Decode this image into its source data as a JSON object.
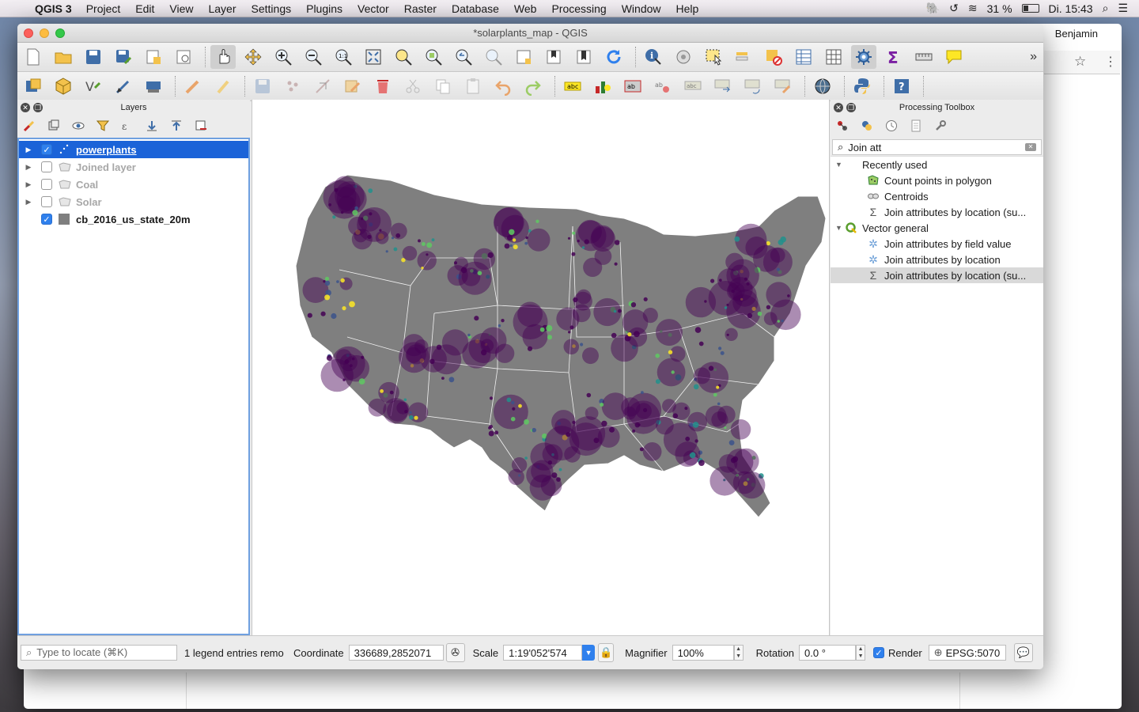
{
  "menubar": {
    "app_name": "QGIS 3",
    "items": [
      "Project",
      "Edit",
      "View",
      "Layer",
      "Settings",
      "Plugins",
      "Vector",
      "Raster",
      "Database",
      "Web",
      "Processing",
      "Window",
      "Help"
    ],
    "battery": "31 %",
    "clock": "Di. 15:43"
  },
  "background_window": {
    "user": "Benjamin"
  },
  "window": {
    "title": "*solarplants_map - QGIS"
  },
  "layers_panel": {
    "title": "Layers",
    "layers": [
      {
        "name": "powerplants",
        "checked": true,
        "selected": true,
        "icon": "point-layer-icon",
        "expandable": true
      },
      {
        "name": "Joined layer",
        "checked": false,
        "selected": false,
        "icon": "polygon-layer-icon",
        "expandable": true
      },
      {
        "name": "Coal",
        "checked": false,
        "selected": false,
        "icon": "polygon-layer-icon",
        "expandable": true
      },
      {
        "name": "Solar",
        "checked": false,
        "selected": false,
        "icon": "polygon-layer-icon",
        "expandable": true
      },
      {
        "name": "cb_2016_us_state_20m",
        "checked": true,
        "selected": false,
        "icon": "fill-swatch-icon",
        "expandable": false
      }
    ]
  },
  "processing_toolbox": {
    "title": "Processing Toolbox",
    "search_value": "Join att",
    "groups": [
      {
        "name": "Recently used",
        "items": [
          {
            "label": "Count points in polygon",
            "icon": "count-points-icon"
          },
          {
            "label": "Centroids",
            "icon": "centroids-icon"
          },
          {
            "label": "Join attributes by location (su...",
            "icon": "sigma-icon"
          }
        ]
      },
      {
        "name": "Vector general",
        "items": [
          {
            "label": "Join attributes by field value",
            "icon": "gear-icon"
          },
          {
            "label": "Join attributes by location",
            "icon": "gear-icon"
          },
          {
            "label": "Join attributes by location (su...",
            "icon": "sigma-icon",
            "selected": true
          }
        ]
      }
    ]
  },
  "statusbar": {
    "locate_placeholder": "Type to locate (⌘K)",
    "message": "1 legend entries remo",
    "coordinate_label": "Coordinate",
    "coordinate_value": "336689,2852071",
    "scale_label": "Scale",
    "scale_value": "1:19'052'574",
    "magnifier_label": "Magnifier",
    "magnifier_value": "100%",
    "rotation_label": "Rotation",
    "rotation_value": "0.0 °",
    "render_label": "Render",
    "render_checked": true,
    "crs": "EPSG:5070"
  },
  "colors": {
    "state_fill": "#7f7f7f",
    "plant_purple": "#440154",
    "plant_teal": "#21918c",
    "plant_yellow": "#fde725",
    "selection": "#1b63d8"
  }
}
